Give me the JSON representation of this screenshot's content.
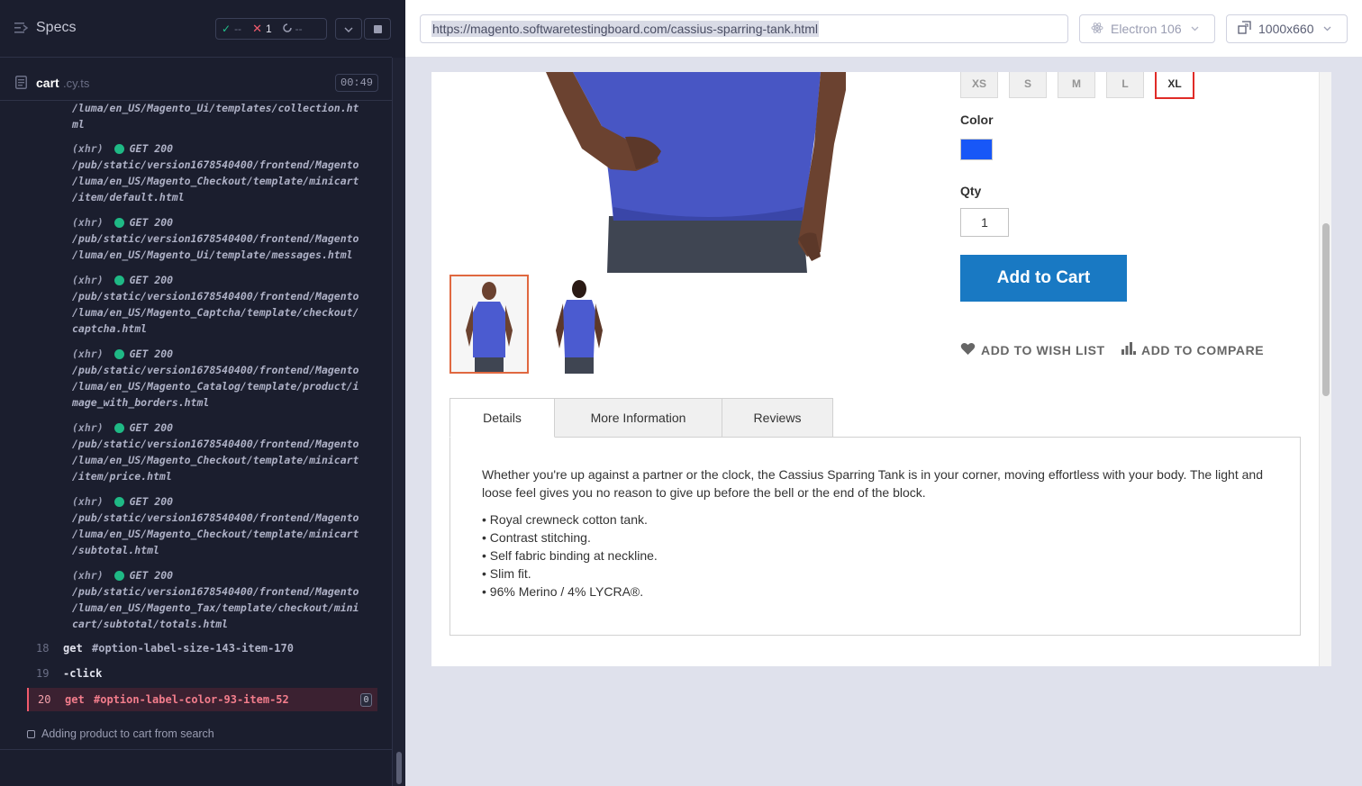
{
  "runner": {
    "title": "Specs",
    "stats": {
      "passed": "--",
      "failed": "1",
      "pending": "--"
    },
    "spec": {
      "name": "cart",
      "ext": ".cy.ts",
      "time": "00:49"
    },
    "log_prefix_lines": [
      "/luma/en_US/Magento_Ui/templates/collection.ht",
      "ml"
    ],
    "xhr": [
      {
        "tag": "(xhr)",
        "method": "GET 200",
        "path": "/pub/static/version1678540400/frontend/Magento\n/luma/en_US/Magento_Checkout/template/minicart\n/item/default.html"
      },
      {
        "tag": "(xhr)",
        "method": "GET 200",
        "path": "/pub/static/version1678540400/frontend/Magento\n/luma/en_US/Magento_Ui/template/messages.html"
      },
      {
        "tag": "(xhr)",
        "method": "GET 200",
        "path": "/pub/static/version1678540400/frontend/Magento\n/luma/en_US/Magento_Captcha/template/checkout/\ncaptcha.html"
      },
      {
        "tag": "(xhr)",
        "method": "GET 200",
        "path": "/pub/static/version1678540400/frontend/Magento\n/luma/en_US/Magento_Catalog/template/product/i\nmage_with_borders.html"
      },
      {
        "tag": "(xhr)",
        "method": "GET 200",
        "path": "/pub/static/version1678540400/frontend/Magento\n/luma/en_US/Magento_Checkout/template/minicart\n/item/price.html"
      },
      {
        "tag": "(xhr)",
        "method": "GET 200",
        "path": "/pub/static/version1678540400/frontend/Magento\n/luma/en_US/Magento_Checkout/template/minicart\n/subtotal.html"
      },
      {
        "tag": "(xhr)",
        "method": "GET 200",
        "path": "/pub/static/version1678540400/frontend/Magento\n/luma/en_US/Magento_Tax/template/checkout/mini\ncart/subtotal/totals.html"
      }
    ],
    "commands": [
      {
        "num": "18",
        "name": "get",
        "selector": "#option-label-size-143-item-170"
      },
      {
        "num": "19",
        "name": "-click",
        "selector": ""
      },
      {
        "num": "20",
        "name": "get",
        "selector": "#option-label-color-93-item-52",
        "badge": "0"
      }
    ],
    "test_title": "Adding product to cart from search"
  },
  "toolbar": {
    "url": "https://magento.softwaretestingboard.com/cassius-sparring-tank.html",
    "browser": "Electron 106",
    "viewport": "1000x660"
  },
  "product": {
    "sizes": [
      "XS",
      "S",
      "M",
      "L",
      "XL"
    ],
    "selected_size": "XL",
    "color_label": "Color",
    "color_value": "#1857f7",
    "qty_label": "Qty",
    "qty_value": "1",
    "add_to_cart": "Add to Cart",
    "wish_list": "ADD TO WISH LIST",
    "compare": "ADD TO COMPARE",
    "tabs": [
      "Details",
      "More Information",
      "Reviews"
    ],
    "description": "Whether you're up against a partner or the clock, the Cassius Sparring Tank is in your corner, moving effortless with your body. The light and loose feel gives you no reason to give up before the bell or the end of the block.",
    "bullets": [
      "• Royal crewneck cotton tank.",
      "• Contrast stitching.",
      "• Self fabric binding at neckline.",
      "• Slim fit.",
      "• 96% Merino / 4% LYCRA®."
    ]
  }
}
